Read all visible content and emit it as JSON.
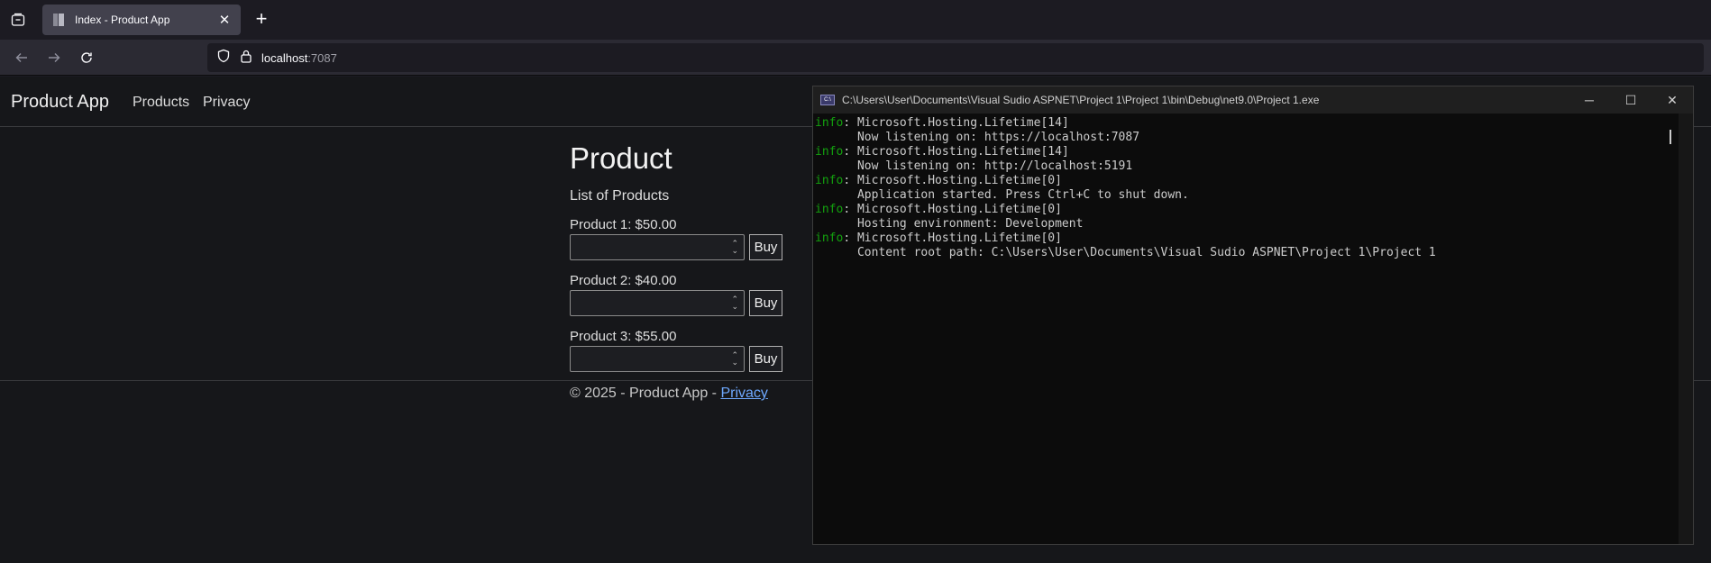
{
  "browser": {
    "tab_title": "Index - Product App",
    "url_host": "localhost",
    "url_port": ":7087"
  },
  "site": {
    "brand": "Product App",
    "nav": [
      "Products",
      "Privacy"
    ],
    "heading": "Product",
    "subtitle": "List of Products",
    "products": [
      {
        "label": "Product 1: $50.00",
        "button": "Buy"
      },
      {
        "label": "Product 2: $40.00",
        "button": "Buy"
      },
      {
        "label": "Product 3: $55.00",
        "button": "Buy"
      }
    ],
    "footer_text": "© 2025 - Product App - ",
    "footer_link": "Privacy"
  },
  "console": {
    "title": "C:\\Users\\User\\Documents\\Visual Sudio ASPNET\\Project 1\\Project 1\\bin\\Debug\\net9.0\\Project 1.exe",
    "lines": [
      {
        "prefix": "info",
        "text": ": Microsoft.Hosting.Lifetime[14]"
      },
      {
        "prefix": "",
        "text": "      Now listening on: https://localhost:7087"
      },
      {
        "prefix": "info",
        "text": ": Microsoft.Hosting.Lifetime[14]"
      },
      {
        "prefix": "",
        "text": "      Now listening on: http://localhost:5191"
      },
      {
        "prefix": "info",
        "text": ": Microsoft.Hosting.Lifetime[0]"
      },
      {
        "prefix": "",
        "text": "      Application started. Press Ctrl+C to shut down."
      },
      {
        "prefix": "info",
        "text": ": Microsoft.Hosting.Lifetime[0]"
      },
      {
        "prefix": "",
        "text": "      Hosting environment: Development"
      },
      {
        "prefix": "info",
        "text": ": Microsoft.Hosting.Lifetime[0]"
      },
      {
        "prefix": "",
        "text": "      Content root path: C:\\Users\\User\\Documents\\Visual Sudio ASPNET\\Project 1\\Project 1"
      }
    ]
  },
  "colors": {
    "info_green": "#13a10e",
    "link_blue": "#6ea8fe"
  }
}
